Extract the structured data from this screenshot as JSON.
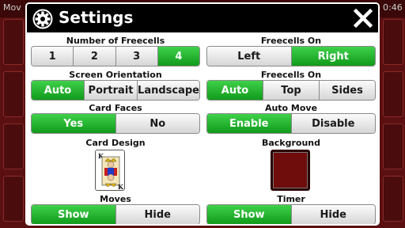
{
  "background": {
    "moves_label": "Mov",
    "time_label": "0:46"
  },
  "dialog": {
    "title": "Settings",
    "icons": {
      "header": "gear-icon",
      "close": "close-icon"
    }
  },
  "settings": {
    "freecells": {
      "label": "Number of Freecells",
      "options": [
        "1",
        "2",
        "3",
        "4"
      ],
      "selected": "4"
    },
    "freecells_on": {
      "label": "Freecells On",
      "options": [
        "Left",
        "Right"
      ],
      "selected": "Right"
    },
    "screen_orientation": {
      "label": "Screen Orientation",
      "options": [
        "Auto",
        "Portrait",
        "Landscape"
      ],
      "selected": "Auto"
    },
    "freecells_on_position": {
      "label": "Freecells On",
      "options": [
        "Auto",
        "Top",
        "Sides"
      ],
      "selected": "Auto"
    },
    "card_faces": {
      "label": "Card Faces",
      "options": [
        "Yes",
        "No"
      ],
      "selected": "Yes"
    },
    "auto_move": {
      "label": "Auto Move",
      "options": [
        "Enable",
        "Disable"
      ],
      "selected": "Enable"
    },
    "card_design": {
      "label": "Card Design",
      "card_rank": "K"
    },
    "background": {
      "label": "Background",
      "color": "#6f0c0c"
    },
    "moves": {
      "label": "Moves",
      "options": [
        "Show",
        "Hide"
      ],
      "selected": "Show"
    },
    "timer": {
      "label": "Timer",
      "options": [
        "Show",
        "Hide"
      ],
      "selected": "Show"
    }
  },
  "colors": {
    "selected": "#1fb02a",
    "unselected": "#e8e8e8",
    "header": "#000000"
  }
}
